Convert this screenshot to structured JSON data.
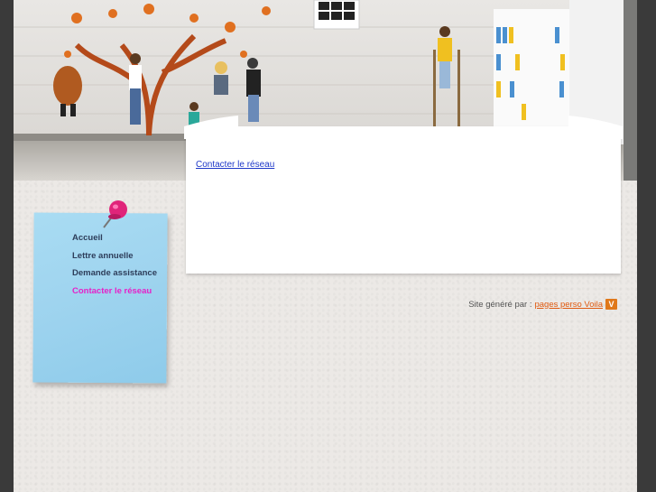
{
  "content": {
    "link_label": "Contacter le réseau"
  },
  "nav": {
    "items": [
      {
        "label": "Accueil"
      },
      {
        "label": "Lettre annuelle"
      },
      {
        "label": "Demande assistance"
      },
      {
        "label": "Contacter le réseau"
      }
    ],
    "active_index": 3
  },
  "footer": {
    "generated_by": "Site généré par :",
    "link_label": "pages perso Voila",
    "logo_letter": "V"
  },
  "colors": {
    "accent_active": "#e621c8",
    "nav_text": "#2d3d5a",
    "link": "#1e38c8",
    "credit_link": "#e05a10"
  }
}
